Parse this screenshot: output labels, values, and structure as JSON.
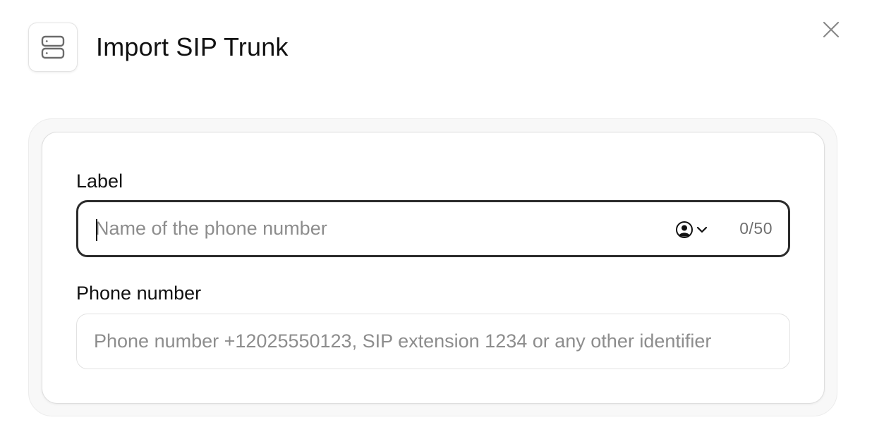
{
  "dialog": {
    "title": "Import SIP Trunk",
    "header_icon": "server-icon",
    "close_icon": "close-icon"
  },
  "form": {
    "label_field": {
      "label": "Label",
      "value": "",
      "placeholder": "Name of the phone number",
      "counter": "0/50",
      "variable_picker_icon": "user-circle-icon",
      "dropdown_icon": "chevron-down-icon"
    },
    "phone_field": {
      "label": "Phone number",
      "value": "",
      "placeholder": "Phone number +12025550123, SIP extension 1234 or any other identifier"
    }
  },
  "colors": {
    "focused_border": "#2b2b2b",
    "input_border": "#e2e2e2",
    "placeholder": "#8d8d8d",
    "panel_background": "#f8f8f8"
  }
}
